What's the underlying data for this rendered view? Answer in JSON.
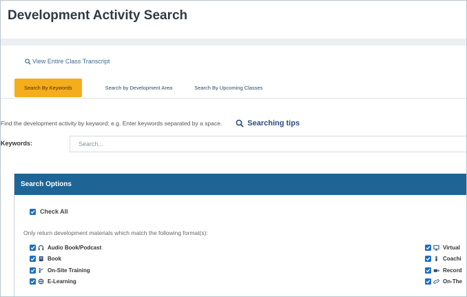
{
  "page": {
    "title": "Development Activity Search"
  },
  "links": {
    "transcript": "View Entire Class Transcript"
  },
  "tabs": [
    {
      "label": "Search By Keywords"
    },
    {
      "label": "Search by Development Area"
    },
    {
      "label": "Search By Upcoming Classes"
    }
  ],
  "search": {
    "hint": "Find the development activity by keyword: e.g. Enter keywords separated by a space.",
    "tips_label": "Searching tips",
    "keywords_label": "Keywords:",
    "placeholder": "Search...",
    "value": ""
  },
  "options": {
    "header": "Search Options",
    "check_all_label": "Check All",
    "only_text": "Only return development materials which match the following format(s):",
    "formats_left": [
      {
        "label": "Audio Book/Podcast",
        "icon": "headphones-icon",
        "checked": true
      },
      {
        "label": "Book",
        "icon": "book-icon",
        "checked": true
      },
      {
        "label": "On-Site Training",
        "icon": "presenter-icon",
        "checked": true
      },
      {
        "label": "E-Learning",
        "icon": "globe-icon",
        "checked": true
      }
    ],
    "formats_right": [
      {
        "label": "Virtual",
        "icon": "monitor-icon",
        "checked": true
      },
      {
        "label": "Coachi",
        "icon": "coach-icon",
        "checked": true
      },
      {
        "label": "Record",
        "icon": "video-icon",
        "checked": true
      },
      {
        "label": "On-The",
        "icon": "link-icon",
        "checked": true
      }
    ]
  },
  "colors": {
    "accent_tab": "#f5ad1c",
    "header_blue": "#1e6494",
    "checkbox_blue": "#1f6fbf",
    "link_blue": "#3a6b8c"
  }
}
